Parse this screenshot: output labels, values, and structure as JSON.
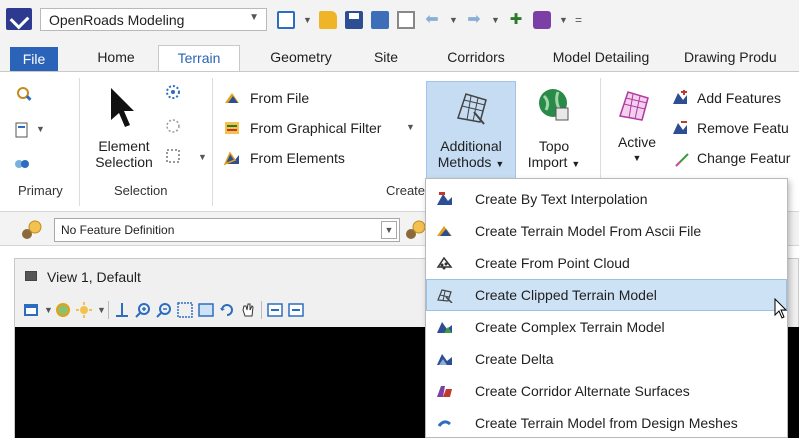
{
  "workflow": {
    "selected": "OpenRoads Modeling"
  },
  "tabs": [
    {
      "label": "File"
    },
    {
      "label": "Home"
    },
    {
      "label": "Terrain"
    },
    {
      "label": "Geometry"
    },
    {
      "label": "Site"
    },
    {
      "label": "Corridors"
    },
    {
      "label": "Model Detailing"
    },
    {
      "label": "Drawing Produ"
    }
  ],
  "ribbon": {
    "primary_label": "Primary",
    "selection": {
      "element_line1": "Element",
      "element_line2": "Selection",
      "group_label": "Selection"
    },
    "create": {
      "from_file": "From File",
      "from_graphical_filter": "From Graphical Filter",
      "from_elements": "From Elements",
      "group_label": "Create"
    },
    "additional_methods": {
      "line1": "Additional",
      "line2": "Methods"
    },
    "topo_import": {
      "line1": "Topo",
      "line2": "Import"
    },
    "active": {
      "label": "Active"
    },
    "edit": {
      "add_features": "Add Features",
      "remove_features": "Remove Featu",
      "change_features": "Change Featur"
    }
  },
  "feature_definition": {
    "value": "No Feature Definition"
  },
  "view": {
    "title": "View 1, Default"
  },
  "menu": {
    "items": [
      {
        "label": "Create By Text Interpolation",
        "icon": "text-interpolation-icon"
      },
      {
        "label": "Create Terrain Model From Ascii File",
        "icon": "ascii-file-icon"
      },
      {
        "label": "Create From Point Cloud",
        "icon": "point-cloud-icon"
      },
      {
        "label": "Create Clipped Terrain Model",
        "icon": "clipped-terrain-icon",
        "highlighted": true
      },
      {
        "label": "Create Complex Terrain Model",
        "icon": "complex-terrain-icon"
      },
      {
        "label": "Create Delta",
        "icon": "delta-icon"
      },
      {
        "label": "Create Corridor Alternate Surfaces",
        "icon": "corridor-surfaces-icon"
      },
      {
        "label": "Create Terrain Model from Design Meshes",
        "icon": "design-meshes-icon"
      }
    ]
  },
  "colors": {
    "accent": "#2b63b8",
    "highlight": "#cde2f5",
    "view_canvas": "#000000"
  }
}
